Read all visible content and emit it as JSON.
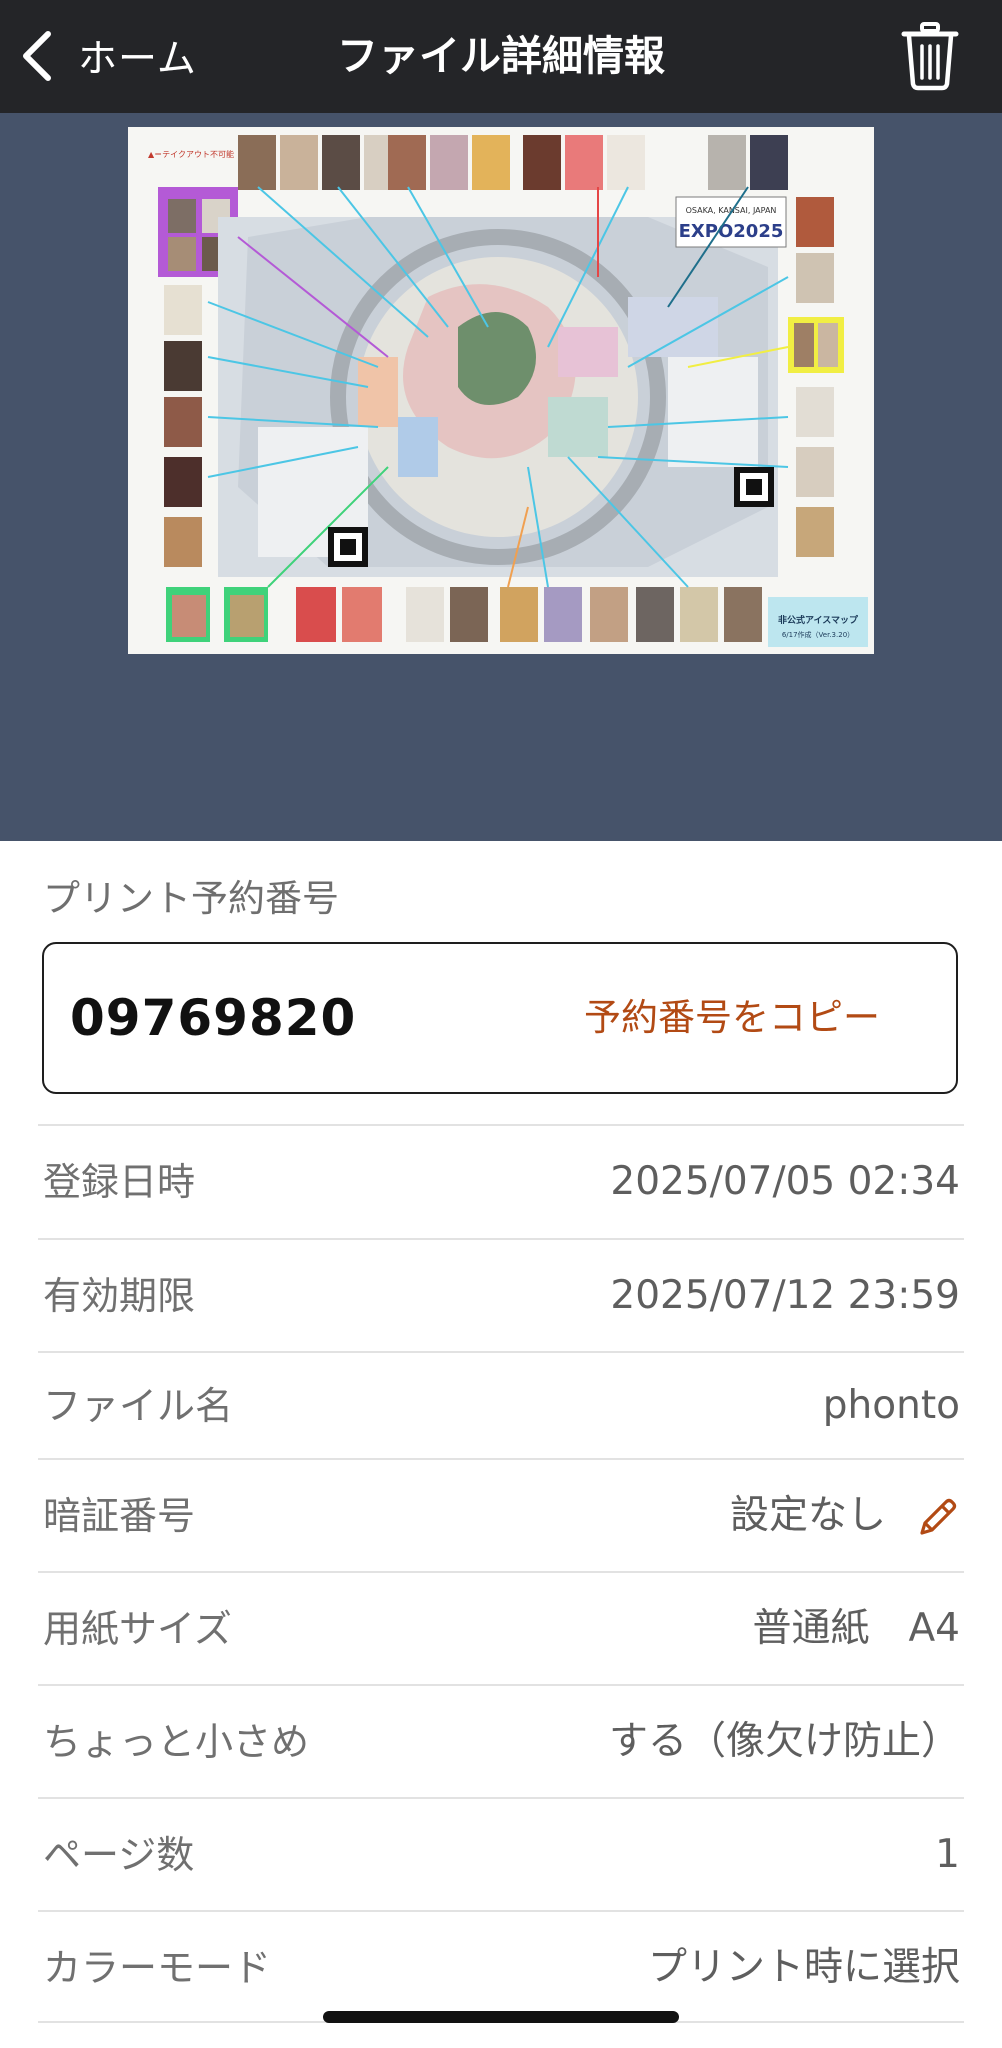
{
  "header": {
    "back_label": "ホーム",
    "title": "ファイル詳細情報"
  },
  "preview": {
    "map_top_note": "▲＝テイクアウト不可能",
    "map_title_line1": "OSAKA, KANSAI, JAPAN",
    "map_title_line2": "EXPO2025",
    "map_badge": "非公式アイスマップ",
    "map_version": "6/17作成（Ver.3.20）"
  },
  "reservation": {
    "label": "プリント予約番号",
    "number": "09769820",
    "copy_label": "予約番号をコピー"
  },
  "details": [
    {
      "key": "登録日時",
      "value": "2025/07/05 02:34"
    },
    {
      "key": "有効期限",
      "value": "2025/07/12 23:59"
    },
    {
      "key": "ファイル名",
      "value": "phonto"
    },
    {
      "key": "暗証番号",
      "value": "設定なし"
    },
    {
      "key": "用紙サイズ",
      "value": "普通紙　A4"
    },
    {
      "key": "ちょっと小さめ",
      "value": "する（像欠け防止）"
    },
    {
      "key": "ページ数",
      "value": "1"
    },
    {
      "key": "カラーモード",
      "value": "プリント時に選択"
    }
  ],
  "colors": {
    "navbar_bg": "#242528",
    "preview_bg": "#46536a",
    "accent": "#b24a14"
  }
}
